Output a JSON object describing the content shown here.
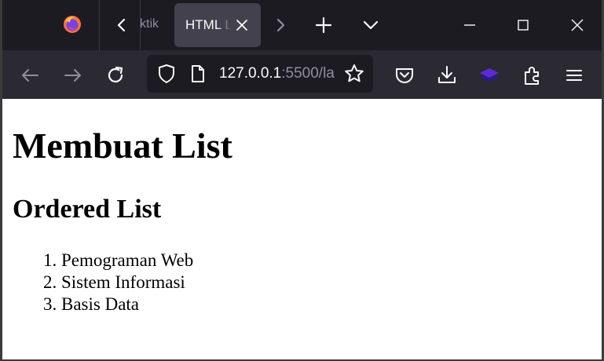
{
  "browser": {
    "tabs": [
      {
        "label": "ktik",
        "active": false
      },
      {
        "label": "HTML L",
        "active": true
      }
    ],
    "url": {
      "host": "127.0.0.1",
      "rest": ":5500/la"
    },
    "icons": {
      "app_logo": "firefox-logo",
      "tab_scroll_left": "chevron-left-icon",
      "tab_close": "close-icon",
      "tab_scroll_right": "chevron-right-icon",
      "new_tab": "plus-icon",
      "tab_list": "chevron-down-icon",
      "minimize": "minimize-icon",
      "maximize": "maximize-icon",
      "close_window": "close-icon",
      "back": "arrow-left-icon",
      "forward": "arrow-right-icon",
      "reload": "reload-icon",
      "tracking_protection": "shield-icon",
      "page_info": "page-icon",
      "bookmark": "star-icon",
      "pocket": "pocket-icon",
      "downloads": "download-icon",
      "extension": "layers-icon",
      "extensions": "puzzle-icon",
      "menu": "hamburger-menu-icon"
    },
    "colors": {
      "tabstrip_bg": "#1c1b22",
      "toolbar_bg": "#2b2a33",
      "active_tab_bg": "#42414d",
      "icon_fg": "#fbfbfe",
      "extension_purple": "#5b2bd6"
    }
  },
  "page": {
    "heading": "Membuat List",
    "subheading": "Ordered List",
    "list_items": [
      "Pemograman Web",
      "Sistem Informasi",
      "Basis Data"
    ]
  }
}
